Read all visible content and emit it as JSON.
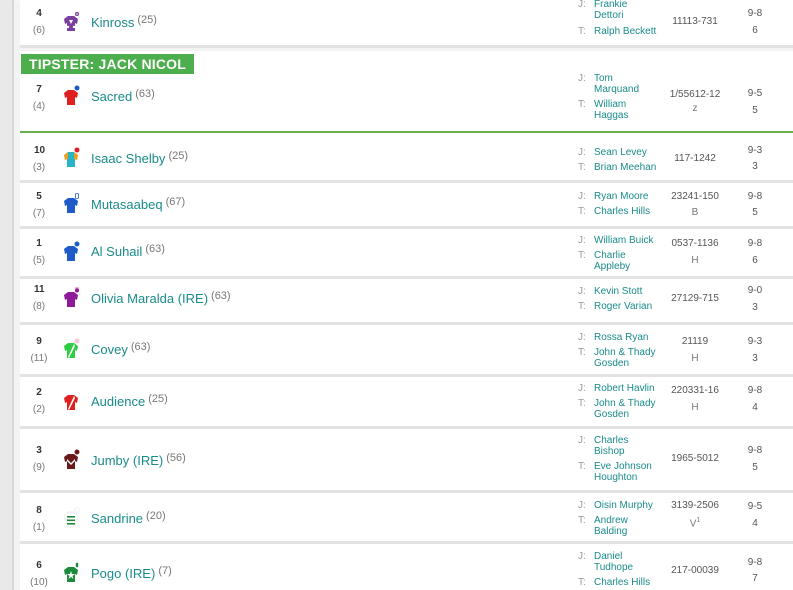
{
  "top_stripe_colors": [
    "#f5f5f5",
    "#f39c12",
    "#2c3e50",
    "#16a085",
    "#9b59b6",
    "#27ae60",
    "#3498db",
    "#c8a06a",
    "#e67e22"
  ],
  "tipster": {
    "label": "TIPSTER: JACK NICOL"
  },
  "runners": [
    {
      "no": "4",
      "draw": "(6)",
      "horse": "Kinross",
      "rating": "(25)",
      "jockey_label": "J:",
      "jockey": "Frankie Dettori",
      "trainer_label": "T:",
      "trainer": "Ralph Beckett",
      "form": "11113-731",
      "equip": "",
      "weight": "9-8",
      "age": "6",
      "silk": "purple-white-stars"
    },
    {
      "no": "7",
      "draw": "(4)",
      "horse": "Sacred",
      "rating": "(63)",
      "jockey_label": "J:",
      "jockey": "Tom Marquand",
      "trainer_label": "T:",
      "trainer": "William Haggas",
      "form": "1/55612-12",
      "equip": "z",
      "weight": "9-5",
      "age": "5",
      "silk": "red-blue-cap"
    },
    {
      "no": "10",
      "draw": "(3)",
      "horse": "Isaac Shelby",
      "rating": "(25)",
      "jockey_label": "J:",
      "jockey": "Sean Levey",
      "trainer_label": "T:",
      "trainer": "Brian Meehan",
      "form": "117-1242",
      "equip": "",
      "weight": "9-3",
      "age": "3",
      "silk": "teal-orange-red-cap"
    },
    {
      "no": "5",
      "draw": "(7)",
      "horse": "Mutasaabeq",
      "rating": "(67)",
      "jockey_label": "J:",
      "jockey": "Ryan Moore",
      "trainer_label": "T:",
      "trainer": "Charles Hills",
      "form": "23241-150",
      "equip": "B",
      "weight": "9-8",
      "age": "5",
      "silk": "blue-white-cap"
    },
    {
      "no": "1",
      "draw": "(5)",
      "horse": "Al Suhail",
      "rating": "(63)",
      "jockey_label": "J:",
      "jockey": "William Buick",
      "trainer_label": "T:",
      "trainer": "Charlie Appleby",
      "form": "0537-1136",
      "equip": "H",
      "weight": "9-8",
      "age": "6",
      "silk": "royal-blue"
    },
    {
      "no": "11",
      "draw": "(8)",
      "horse": "Olivia Maralda (IRE)",
      "rating": "(63)",
      "jockey_label": "J:",
      "jockey": "Kevin Stott",
      "trainer_label": "T:",
      "trainer": "Roger Varian",
      "form": "27129-715",
      "equip": "",
      "weight": "9-0",
      "age": "3",
      "silk": "purple-pink-cap"
    },
    {
      "no": "9",
      "draw": "(11)",
      "horse": "Covey",
      "rating": "(63)",
      "jockey_label": "J:",
      "jockey": "Rossa Ryan",
      "trainer_label": "T:",
      "trainer": "John & Thady Gosden",
      "form": "21119",
      "equip": "H",
      "weight": "9-3",
      "age": "3",
      "silk": "green-white-sash"
    },
    {
      "no": "2",
      "draw": "(2)",
      "horse": "Audience",
      "rating": "(25)",
      "jockey_label": "J:",
      "jockey": "Robert Havlin",
      "trainer_label": "T:",
      "trainer": "John & Thady Gosden",
      "form": "220331-16",
      "equip": "H",
      "weight": "9-8",
      "age": "4",
      "silk": "red-white-sash"
    },
    {
      "no": "3",
      "draw": "(9)",
      "horse": "Jumby (IRE)",
      "rating": "(56)",
      "jockey_label": "J:",
      "jockey": "Charles Bishop",
      "trainer_label": "T:",
      "trainer": "Eve Johnson Houghton",
      "form": "1965-5012",
      "equip": "H",
      "weight": "9-8",
      "age": "5",
      "silk": "maroon-white-chevron"
    },
    {
      "no": "8",
      "draw": "(1)",
      "horse": "Sandrine",
      "rating": "(20)",
      "jockey_label": "J:",
      "jockey": "Oisin Murphy",
      "trainer_label": "T:",
      "trainer": "Andrew Balding",
      "form": "3139-2506",
      "equip": "V1",
      "weight": "9-5",
      "age": "4",
      "silk": "white-green-hoops"
    },
    {
      "no": "6",
      "draw": "(10)",
      "horse": "Pogo (IRE)",
      "rating": "(7)",
      "jockey_label": "J:",
      "jockey": "Daniel Tudhope",
      "trainer_label": "T:",
      "trainer": "Charles Hills",
      "form": "217-00039",
      "equip": "",
      "weight": "9-8",
      "age": "7",
      "silk": "green-white-star"
    }
  ]
}
